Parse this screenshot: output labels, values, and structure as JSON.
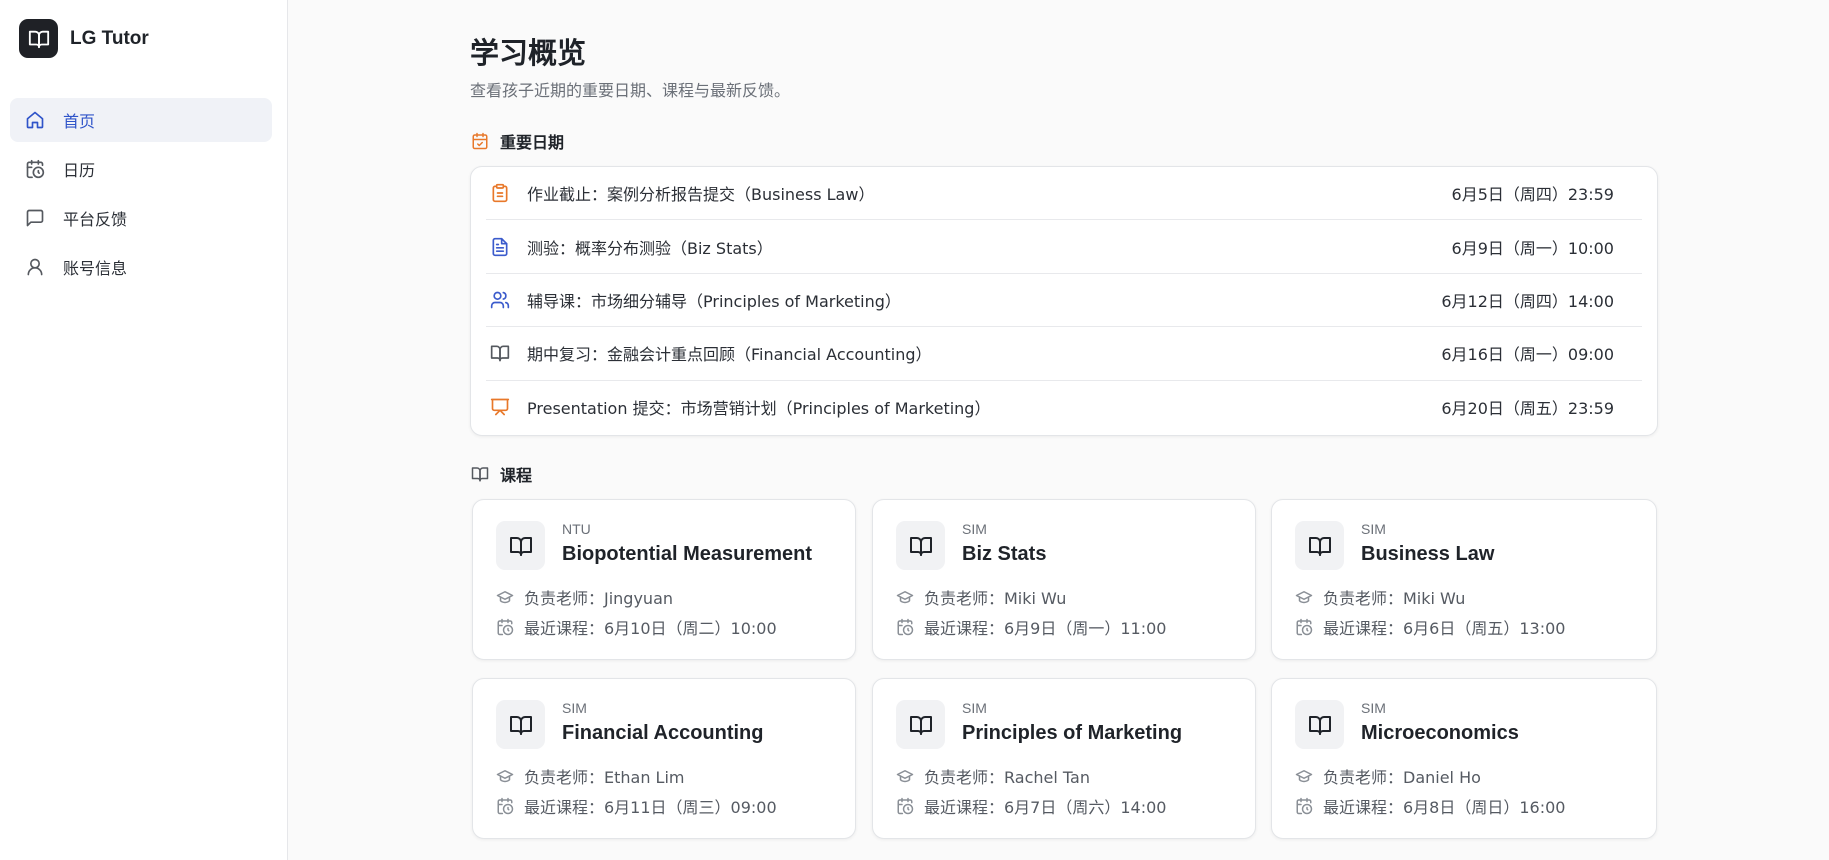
{
  "app": {
    "name": "LG Tutor"
  },
  "sidebar": {
    "items": [
      {
        "label": "首页",
        "icon": "home-icon",
        "active": true
      },
      {
        "label": "日历",
        "icon": "calendar-clock-icon",
        "active": false
      },
      {
        "label": "平台反馈",
        "icon": "message-square-icon",
        "active": false
      },
      {
        "label": "账号信息",
        "icon": "user-icon",
        "active": false
      }
    ]
  },
  "main": {
    "title": "学习概览",
    "subtitle": "查看孩子近期的重要日期、课程与最新反馈。",
    "dates_section": {
      "title": "重要日期",
      "items": [
        {
          "icon": "clipboard-icon",
          "text": "作业截止：案例分析报告提交（Business Law）",
          "date": "6月5日（周四）23:59"
        },
        {
          "icon": "file-text-icon",
          "text": "测验：概率分布测验（Biz Stats）",
          "date": "6月9日（周一）10:00"
        },
        {
          "icon": "users-icon",
          "text": "辅导课：市场细分辅导（Principles of Marketing）",
          "date": "6月12日（周四）14:00"
        },
        {
          "icon": "book-open-icon",
          "text": "期中复习：金融会计重点回顾（Financial Accounting）",
          "date": "6月16日（周一）09:00"
        },
        {
          "icon": "presentation-icon",
          "text": "Presentation 提交：市场营销计划（Principles of Marketing）",
          "date": "6月20日（周五）23:59"
        }
      ]
    },
    "courses_section": {
      "title": "课程",
      "courses": [
        {
          "school": "NTU",
          "name": "Biopotential Measurement",
          "teacher": "负责老师：Jingyuan",
          "next": "最近课程：6月10日（周二）10:00"
        },
        {
          "school": "SIM",
          "name": "Biz Stats",
          "teacher": "负责老师：Miki Wu",
          "next": "最近课程：6月9日（周一）11:00"
        },
        {
          "school": "SIM",
          "name": "Business Law",
          "teacher": "负责老师：Miki Wu",
          "next": "最近课程：6月6日（周五）13:00"
        },
        {
          "school": "SIM",
          "name": "Financial Accounting",
          "teacher": "负责老师：Ethan Lim",
          "next": "最近课程：6月11日（周三）09:00"
        },
        {
          "school": "SIM",
          "name": "Principles of Marketing",
          "teacher": "负责老师：Rachel Tan",
          "next": "最近课程：6月7日（周六）14:00"
        },
        {
          "school": "SIM",
          "name": "Microeconomics",
          "teacher": "负责老师：Daniel Ho",
          "next": "最近课程：6月8日（周日）16:00"
        }
      ]
    }
  },
  "colors": {
    "accent": "#2f54c9",
    "orange": "#e8782a",
    "blue_icon": "#3b5bcc",
    "gray_icon": "#55595f"
  }
}
